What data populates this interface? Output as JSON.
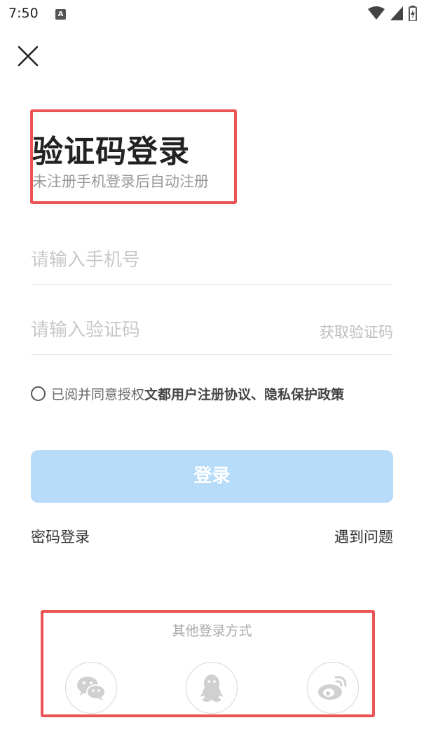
{
  "status_bar": {
    "time": "7:50",
    "notification_glyph": "A",
    "icons": [
      "wifi-icon",
      "signal-icon",
      "battery-icon"
    ]
  },
  "header": {
    "close_icon": "close-icon"
  },
  "title": {
    "main": "验证码登录",
    "subtitle": "未注册手机登录后自动注册"
  },
  "form": {
    "phone_placeholder": "请输入手机号",
    "phone_value": "",
    "code_placeholder": "请输入验证码",
    "code_value": "",
    "get_code_label": "获取验证码"
  },
  "agreement": {
    "checked": false,
    "prefix": "已阅并同意授权",
    "links": "文都用户注册协议、隐私保护政策"
  },
  "login_button": {
    "label": "登录",
    "color": "#b7dcfa"
  },
  "links": {
    "password_login": "密码登录",
    "help": "遇到问题"
  },
  "other_login": {
    "label": "其他登录方式",
    "providers": [
      "wechat-icon",
      "qq-icon",
      "weibo-icon"
    ]
  },
  "colors": {
    "annotation_box": "#ea5455",
    "placeholder": "#c8c8c8",
    "subtitle": "#999999"
  }
}
